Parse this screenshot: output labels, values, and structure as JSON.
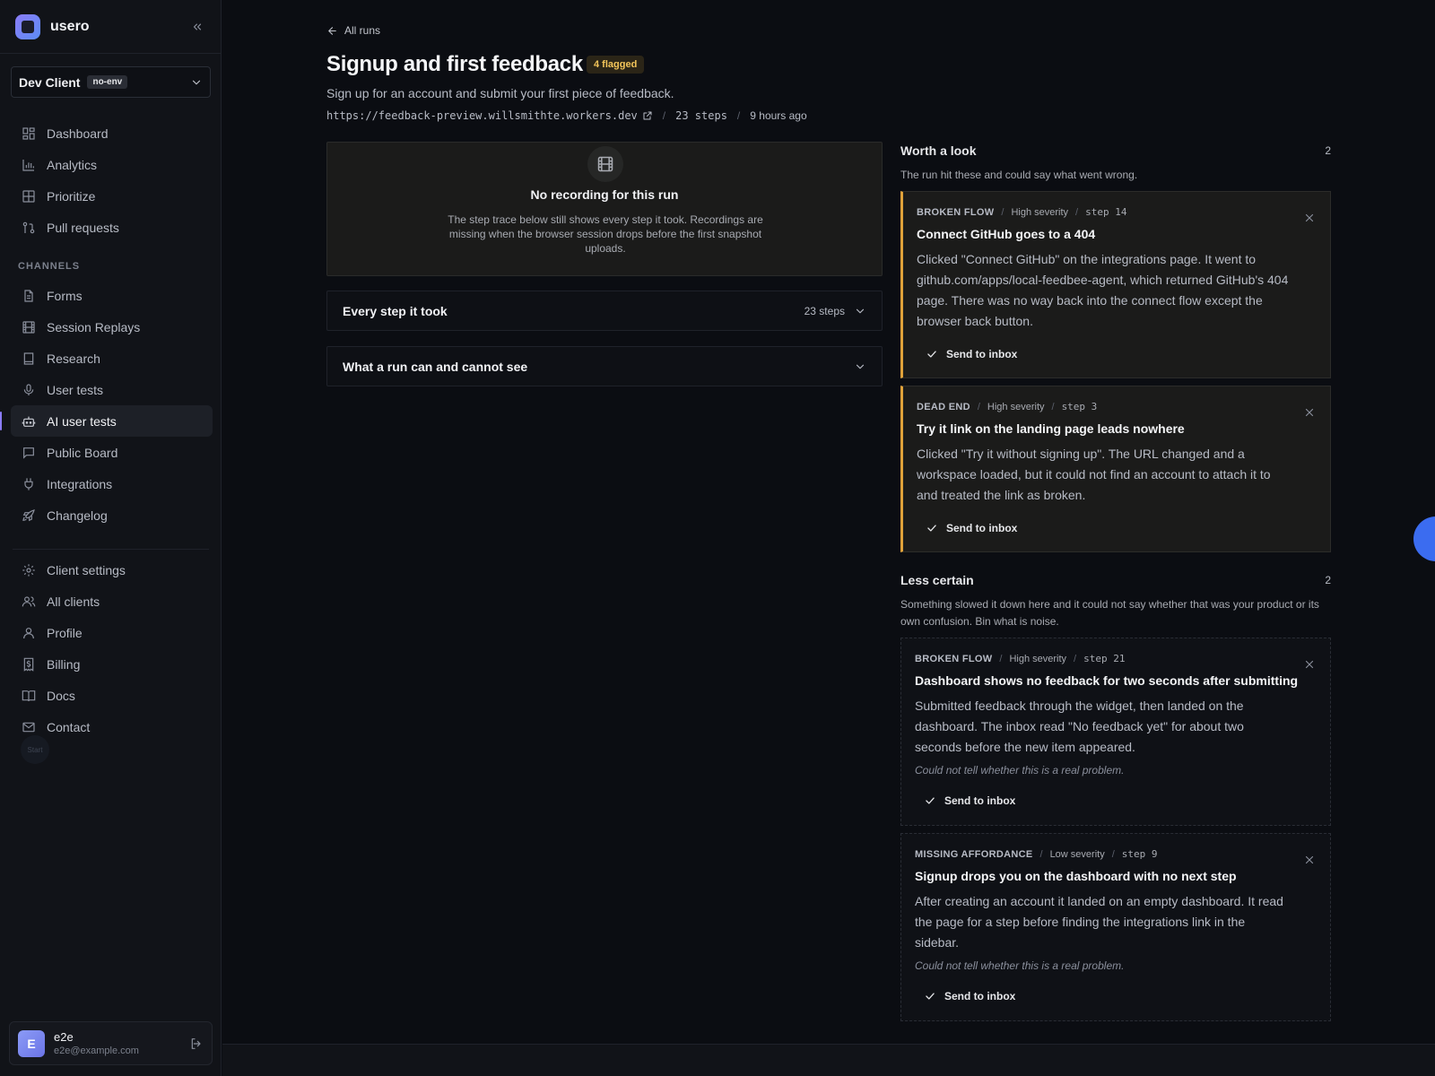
{
  "brand": {
    "name": "usero"
  },
  "client_selector": {
    "name": "Dev Client",
    "env_badge": "no-env"
  },
  "nav": {
    "main": [
      {
        "label": "Dashboard",
        "icon": "layout-dashboard-icon"
      },
      {
        "label": "Analytics",
        "icon": "bar-chart-icon"
      },
      {
        "label": "Prioritize",
        "icon": "grid-icon"
      },
      {
        "label": "Pull requests",
        "icon": "git-pull-request-icon"
      }
    ],
    "channels_label": "CHANNELS",
    "channels": [
      {
        "label": "Forms",
        "icon": "file-text-icon"
      },
      {
        "label": "Session Replays",
        "icon": "film-icon"
      },
      {
        "label": "Research",
        "icon": "book-icon"
      },
      {
        "label": "User tests",
        "icon": "microphone-icon"
      },
      {
        "label": "AI user tests",
        "icon": "bot-icon",
        "active": true
      },
      {
        "label": "Public Board",
        "icon": "message-square-icon"
      },
      {
        "label": "Integrations",
        "icon": "plug-icon"
      },
      {
        "label": "Changelog",
        "icon": "rocket-icon"
      }
    ],
    "settings": [
      {
        "label": "Client settings",
        "icon": "gear-icon"
      },
      {
        "label": "All clients",
        "icon": "users-icon"
      },
      {
        "label": "Profile",
        "icon": "user-icon"
      },
      {
        "label": "Billing",
        "icon": "receipt-dollar-icon"
      },
      {
        "label": "Docs",
        "icon": "book-open-icon"
      },
      {
        "label": "Contact",
        "icon": "mail-icon"
      }
    ],
    "start_label": "Start"
  },
  "user": {
    "initial": "E",
    "name": "e2e",
    "email": "e2e@example.com"
  },
  "header": {
    "back_label": "All runs",
    "title": "Signup and first feedback",
    "flag_badge": "4 flagged",
    "subtitle": "Sign up for an account and submit your first piece of feedback.",
    "url": "https://feedback-preview.willsmithte.workers.dev",
    "steps": "23 steps",
    "time_ago": "9 hours ago"
  },
  "recording": {
    "title": "No recording for this run",
    "description": "The step trace below still shows every step it took. Recordings are missing when the browser session drops before the first snapshot uploads."
  },
  "accordions": {
    "steps": {
      "title": "Every step it took",
      "count": "23 steps"
    },
    "visibility": {
      "title": "What a run can and cannot see"
    }
  },
  "worth_a_look": {
    "title": "Worth a look",
    "count": "2",
    "description": "The run hit these and could say what went wrong.",
    "cards": [
      {
        "category": "BROKEN FLOW",
        "severity": "High severity",
        "step": "step 14",
        "title": "Connect GitHub goes to a 404",
        "body": "Clicked \"Connect GitHub\" on the integrations page. It went to github.com/apps/local-feedbee-agent, which returned GitHub's 404 page. There was no way back into the connect flow except the browser back button.",
        "action": "Send to inbox"
      },
      {
        "category": "DEAD END",
        "severity": "High severity",
        "step": "step 3",
        "title": "Try it link on the landing page leads nowhere",
        "body": "Clicked \"Try it without signing up\". The URL changed and a workspace loaded, but it could not find an account to attach it to and treated the link as broken.",
        "action": "Send to inbox"
      }
    ]
  },
  "less_certain": {
    "title": "Less certain",
    "count": "2",
    "description": "Something slowed it down here and it could not say whether that was your product or its own confusion. Bin what is noise.",
    "cards": [
      {
        "category": "BROKEN FLOW",
        "severity": "High severity",
        "step": "step 21",
        "title": "Dashboard shows no feedback for two seconds after submitting",
        "body": "Submitted feedback through the widget, then landed on the dashboard. The inbox read \"No feedback yet\" for about two seconds before the new item appeared.",
        "note": "Could not tell whether this is a real problem.",
        "action": "Send to inbox"
      },
      {
        "category": "MISSING AFFORDANCE",
        "severity": "Low severity",
        "step": "step 9",
        "title": "Signup drops you on the dashboard with no next step",
        "body": "After creating an account it landed on an empty dashboard. It read the page for a step before finding the integrations link in the sidebar.",
        "note": "Could not tell whether this is a real problem.",
        "action": "Send to inbox"
      }
    ]
  },
  "colors": {
    "accent": "#8b7cf6",
    "flag": "#f2c45a",
    "certain_border": "#e0a23a",
    "fab": "#3b6cf0"
  }
}
